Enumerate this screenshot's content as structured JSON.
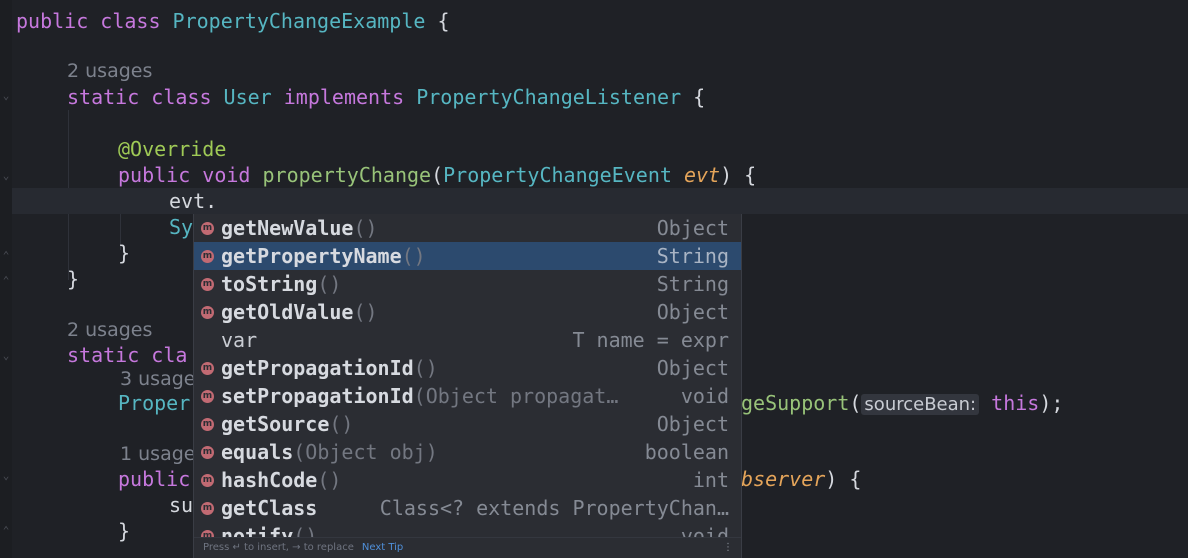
{
  "code": {
    "line1": {
      "kw": "public class ",
      "cls": "PropertyChangeExample",
      "rest": " {"
    },
    "hint1": "2 usages",
    "line2": {
      "kw": "static class ",
      "cls": "User",
      "kw2": " implements ",
      "cls2": "PropertyChangeListener",
      "rest": " {"
    },
    "line3": {
      "ann": "@Override"
    },
    "line4": {
      "kw": "public void ",
      "fn": "propertyChange",
      "p1": "(",
      "cls": "PropertyChangeEvent",
      "sp": " ",
      "param": "evt",
      "rest": ") {"
    },
    "line5": {
      "text": "evt."
    },
    "line6": {
      "text": "Sy"
    },
    "line7": {
      "text": "}"
    },
    "line8": {
      "text": "}"
    },
    "hint2": "2 usages",
    "line9": {
      "kw": "static cla"
    },
    "hint3": "3 usage",
    "line10": {
      "cls": "Proper",
      "fn": "geSupport",
      "p": "(",
      "inlay": "sourceBean:",
      "kw": " this",
      "rest": ");"
    },
    "hint4": "1 usage",
    "line11": {
      "kw": "public",
      "param": "bserver",
      "rest": ") {"
    },
    "line12": {
      "text": "su"
    },
    "line13": {
      "text": "}"
    }
  },
  "completion": {
    "items": [
      {
        "name": "getNewValue",
        "args": "()",
        "type": "Object",
        "icon": "m"
      },
      {
        "name": "getPropertyName",
        "args": "()",
        "type": "String",
        "icon": "m",
        "selected": true
      },
      {
        "name": "toString",
        "args": "()",
        "type": "String",
        "icon": "m"
      },
      {
        "name": "getOldValue",
        "args": "()",
        "type": "Object",
        "icon": "m"
      },
      {
        "name": "var",
        "args": "",
        "type": "T name = expr",
        "icon": ""
      },
      {
        "name": "getPropagationId",
        "args": "()",
        "type": "Object",
        "icon": "m"
      },
      {
        "name": "setPropagationId",
        "args": "(Object propagat…",
        "type": "void",
        "icon": "m"
      },
      {
        "name": "getSource",
        "args": "()",
        "type": "Object",
        "icon": "m"
      },
      {
        "name": "equals",
        "args": "(Object obj)",
        "type": "boolean",
        "icon": "m"
      },
      {
        "name": "hashCode",
        "args": "()",
        "type": "int",
        "icon": "m"
      },
      {
        "name": "getClass",
        "args": "",
        "type": "Class<? extends PropertyChan…",
        "icon": "m"
      },
      {
        "name": "notify",
        "args": "()",
        "type": "void",
        "icon": "m"
      }
    ],
    "footer_text": "Press ↵ to insert, → to replace",
    "footer_tip": "Next Tip",
    "footer_menu": "⋮"
  }
}
